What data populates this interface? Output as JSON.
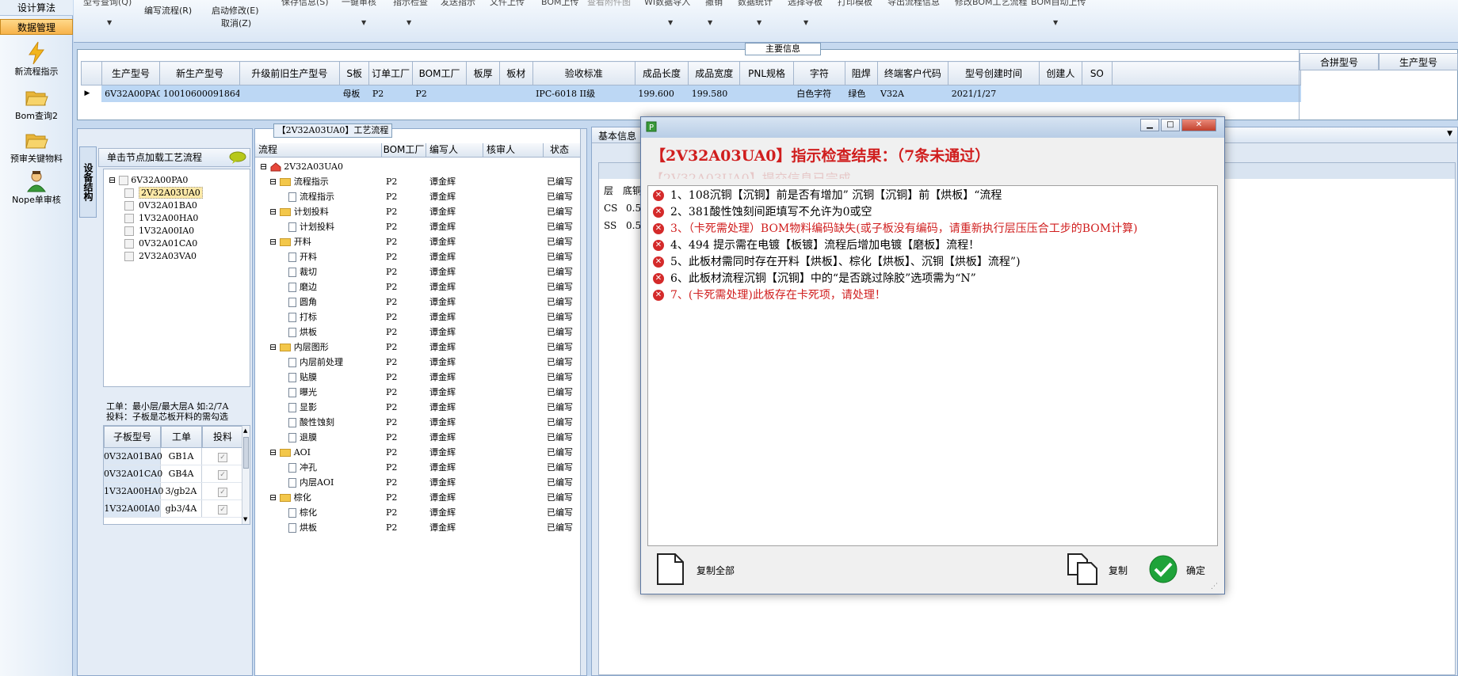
{
  "nav": {
    "design_algo": "设计算法",
    "data_mgmt": "数据管理",
    "items": [
      "新流程指示",
      "Bom查询2",
      "预审关键物料",
      "Nope单审核"
    ]
  },
  "toolbar": {
    "write_flow": "编写流程(R)",
    "start_edit": "启动修改(E)",
    "cancel": "取消(Z)",
    "faded": [
      "型号查询(Q)",
      "保存信息(S)",
      "一键审核",
      "指示检查",
      "发送指示",
      "文件上传",
      "BOM上传",
      "查看附件图",
      "WI数据导入",
      "撤销",
      "数据统计",
      "选择导板",
      "打印模板",
      "导出流程信息",
      "修改BOM工艺流程",
      "BOM自动上传"
    ]
  },
  "main_info": {
    "title": "主要信息",
    "headers": [
      "生产型号",
      "新生产型号",
      "升级前旧生产型号",
      "S板",
      "订单工厂",
      "BOM工厂",
      "板厚",
      "板材",
      "验收标准",
      "成品长度",
      "成品宽度",
      "PNL规格",
      "字符",
      "阻焊",
      "终端客户代码",
      "型号创建时间",
      "创建人",
      "SO"
    ],
    "row": [
      "6V32A00PA0",
      "10010600091864",
      "",
      "母板",
      "P2",
      "P2",
      "",
      "",
      "IPC-6018 II级",
      "199.600",
      "199.580",
      "",
      "白色字符",
      "绿色",
      "V32A",
      "2021/1/27",
      "",
      ""
    ],
    "right_headers": [
      "合拼型号",
      "生产型号"
    ]
  },
  "left_panel": {
    "vtab": "设备结构",
    "hint": "单击节点加载工艺流程",
    "tree_root": "6V32A00PA0",
    "tree_children": [
      "2V32A03UA0",
      "0V32A01BA0",
      "1V32A00HA0",
      "1V32A00IA0",
      "0V32A01CA0",
      "2V32A03VA0"
    ],
    "note_line1": "工单：最小层/最大层A 如:2/7A",
    "note_line2": "投料：子板是芯板开料的需勾选",
    "sub_headers": [
      "子板型号",
      "工单",
      "投料"
    ],
    "sub_rows": [
      [
        "0V32A01BA0",
        "GB1A"
      ],
      [
        "0V32A01CA0",
        "GB4A"
      ],
      [
        "1V32A00HA0",
        "3/gb2A"
      ],
      [
        "1V32A00IA0",
        "gb3/4A"
      ]
    ]
  },
  "process": {
    "title": "【2V32A03UA0】工艺流程",
    "headers": [
      "流程",
      "BOM工厂",
      "编写人",
      "核审人",
      "状态"
    ],
    "root": "2V32A03UA0",
    "rows": [
      {
        "level": 1,
        "name": "流程指示",
        "factory": "P2",
        "writer": "谭金辉",
        "status": "已编写"
      },
      {
        "level": 2,
        "name": "流程指示",
        "factory": "P2",
        "writer": "谭金辉",
        "status": "已编写"
      },
      {
        "level": 1,
        "name": "计划投料",
        "factory": "P2",
        "writer": "谭金辉",
        "status": "已编写"
      },
      {
        "level": 2,
        "name": "计划投料",
        "factory": "P2",
        "writer": "谭金辉",
        "status": "已编写"
      },
      {
        "level": 1,
        "name": "开料",
        "factory": "P2",
        "writer": "谭金辉",
        "status": "已编写"
      },
      {
        "level": 2,
        "name": "开料",
        "factory": "P2",
        "writer": "谭金辉",
        "status": "已编写"
      },
      {
        "level": 2,
        "name": "裁切",
        "factory": "P2",
        "writer": "谭金辉",
        "status": "已编写"
      },
      {
        "level": 2,
        "name": "磨边",
        "factory": "P2",
        "writer": "谭金辉",
        "status": "已编写"
      },
      {
        "level": 2,
        "name": "圆角",
        "factory": "P2",
        "writer": "谭金辉",
        "status": "已编写"
      },
      {
        "level": 2,
        "name": "打标",
        "factory": "P2",
        "writer": "谭金辉",
        "status": "已编写"
      },
      {
        "level": 2,
        "name": "烘板",
        "factory": "P2",
        "writer": "谭金辉",
        "status": "已编写"
      },
      {
        "level": 1,
        "name": "内层图形",
        "factory": "P2",
        "writer": "谭金辉",
        "status": "已编写"
      },
      {
        "level": 2,
        "name": "内层前处理",
        "factory": "P2",
        "writer": "谭金辉",
        "status": "已编写"
      },
      {
        "level": 2,
        "name": "贴膜",
        "factory": "P2",
        "writer": "谭金辉",
        "status": "已编写"
      },
      {
        "level": 2,
        "name": "曝光",
        "factory": "P2",
        "writer": "谭金辉",
        "status": "已编写"
      },
      {
        "level": 2,
        "name": "显影",
        "factory": "P2",
        "writer": "谭金辉",
        "status": "已编写"
      },
      {
        "level": 2,
        "name": "酸性蚀刻",
        "factory": "P2",
        "writer": "谭金辉",
        "status": "已编写"
      },
      {
        "level": 2,
        "name": "退膜",
        "factory": "P2",
        "writer": "谭金辉",
        "status": "已编写"
      },
      {
        "level": 1,
        "name": "AOI",
        "factory": "P2",
        "writer": "谭金辉",
        "status": "已编写"
      },
      {
        "level": 2,
        "name": "冲孔",
        "factory": "P2",
        "writer": "谭金辉",
        "status": "已编写"
      },
      {
        "level": 2,
        "name": "内层AOI",
        "factory": "P2",
        "writer": "谭金辉",
        "status": "已编写"
      },
      {
        "level": 1,
        "name": "棕化",
        "factory": "P2",
        "writer": "谭金辉",
        "status": "已编写"
      },
      {
        "level": 2,
        "name": "棕化",
        "factory": "P2",
        "writer": "谭金辉",
        "status": "已编写"
      },
      {
        "level": 2,
        "name": "烘板",
        "factory": "P2",
        "writer": "谭金辉",
        "status": "已编写"
      }
    ]
  },
  "right_panel": {
    "tab": "基本信息",
    "col_layer": "层",
    "col_base": "底铜",
    "rows": [
      [
        "CS",
        "0.5"
      ],
      [
        "SS",
        "0.5"
      ]
    ]
  },
  "dialog": {
    "headline": "【2V32A03UA0】指示检查结果：（7条未通过）",
    "ghost_line": "【2V32A03UA0】提交信息已完成",
    "messages": [
      {
        "text": "1、108沉铜【沉铜】前是否有增加” 沉铜【沉铜】前【烘板】“流程",
        "red": false
      },
      {
        "text": "2、381酸性蚀刻间距填写不允许为0或空",
        "red": false
      },
      {
        "text": "3、（卡死需处理）BOM物料编码缺失(或子板没有编码，请重新执行层压压合工步的BOM计算)",
        "red": true
      },
      {
        "text": "4、494 提示需在电镀【板镀】流程后增加电镀【磨板】流程！",
        "red": false
      },
      {
        "text": "5、此板材需同时存在开料【烘板】、棕化【烘板】、沉铜【烘板】流程”)",
        "red": false
      },
      {
        "text": "6、此板材流程沉铜【沉铜】中的“是否跳过除胶”选项需为“N”",
        "red": false
      },
      {
        "text": "7、(卡死需处理)此板存在卡死项，请处理！",
        "red": true
      }
    ],
    "copy_all": "复制全部",
    "copy": "复制",
    "ok": "确定"
  }
}
